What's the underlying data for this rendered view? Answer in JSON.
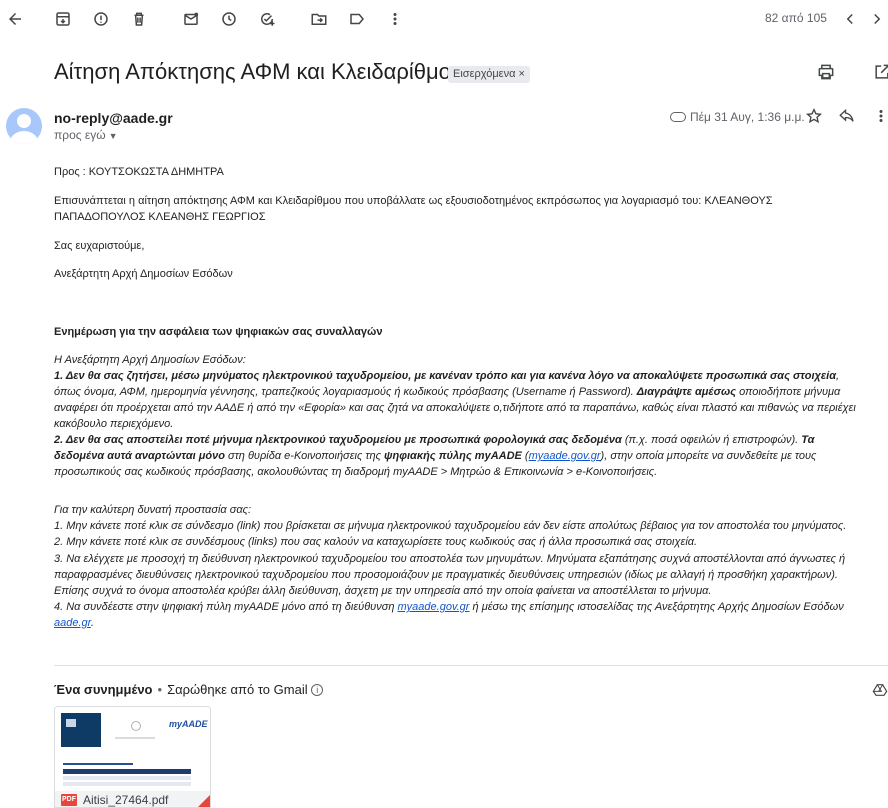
{
  "toolbar": {
    "pager_text": "82 από 105"
  },
  "email": {
    "subject": "Αίτηση Απόκτησης ΑΦΜ και Κλειδαρίθμου",
    "label": "Εισερχόμενα",
    "label_close": "×",
    "sender": "no-reply@aade.gr",
    "recipient": "προς εγώ",
    "date": "Πέμ 31 Αυγ, 1:36 μ.μ."
  },
  "body": {
    "greeting": "Προς : ΚΟΥΤΣΟΚΩΣΤΑ ΔΗΜΗΤΡΑ",
    "para1_line1": "Επισυνάπτεται η αίτηση απόκτησης ΑΦΜ και Κλειδαρίθμου που υποβάλλατε ως εξουσιοδοτημένος εκπρόσωπος για λογαριασμό του: ΚΛΕΑΝΘΟΥΣ",
    "para1_line2": "ΠΑΠΑΔΟΠΟΥΛΟΣ ΚΛΕΑΝΘΗΣ ΓΕΩΡΓΙΟΣ",
    "thanks": "Σας ευχαριστούμε,",
    "signature": "Ανεξάρτητη Αρχή Δημοσίων Εσόδων",
    "security_title": "Ενημέρωση για την ασφάλεια των ψηφιακών σας συναλλαγών",
    "sec_intro": "Η Ανεξάρτητη Αρχή Δημοσίων Εσόδων:",
    "sec1_l1_bold": "1. Δεν θα σας ζητήσει, μέσω μηνύματος ηλεκτρονικού ταχυδρομείου, με κανέναν τρόπο και για κανένα λόγο να αποκαλύψετε προσωπικά σας στοιχεία",
    "sec1_l1_end": ",",
    "sec1_l2_a": "όπως όνομα, ΑΦΜ, ημερομηνία γέννησης, τραπεζικούς λογαριασμούς ή κωδικούς πρόσβασης (Username ή Password). ",
    "sec1_l2_bold": "Διαγράψτε αμέσως",
    "sec1_l2_b": " οποιοδήποτε μήνυμα",
    "sec1_l3": "αναφέρει ότι προέρχεται από την ΑΑΔΕ ή από την «Εφορία» και σας ζητά να αποκαλύψετε ο,τιδήποτε από τα παραπάνω, καθώς είναι πλαστό και πιθανώς να περιέχει",
    "sec1_l4": "κακόβουλο περιεχόμενο.",
    "sec2_l1_bold": "2. Δεν θα σας αποστείλει ποτέ μήνυμα ηλεκτρονικού ταχυδρομείου με προσωπικά φορολογικά σας δεδομένα",
    "sec2_l1_a": " (π.χ. ποσά οφειλών ή επιστροφών). ",
    "sec2_l1_bold2": "Τα",
    "sec2_l2_bold": "δεδομένα αυτά αναρτώνται μόνο",
    "sec2_l2_a": " στη θυρίδα e-Κοινοποιήσεις της ",
    "sec2_l2_bold2": "ψηφιακής πύλης myAADE",
    "sec2_l2_b": " (",
    "sec2_link": "myaade.gov.gr",
    "sec2_l2_c": "), στην οποία μπορείτε να συνδεθείτε με τους",
    "sec2_l3": "προσωπικούς σας κωδικούς πρόσβασης, ακολουθώντας τη διαδρομή myAADE > Μητρώο & Επικοινωνία > e-Κοινοποιήσεις.",
    "tips_intro": "Για την καλύτερη δυνατή προστασία σας:",
    "tip1": "1. Μην κάνετε ποτέ κλικ σε σύνδεσμο (link) που βρίσκεται σε μήνυμα ηλεκτρονικού ταχυδρομείου εάν δεν είστε απολύτως βέβαιος για τον αποστολέα του μηνύματος.",
    "tip2": "2. Μην κάνετε ποτέ κλικ σε συνδέσμους (links) που σας καλούν να καταχωρίσετε τους κωδικούς σας ή άλλα προσωπικά σας στοιχεία.",
    "tip3_l1": "3. Να ελέγχετε με προσοχή τη διεύθυνση ηλεκτρονικού ταχυδρομείου του αποστολέα των μηνυμάτων. Μηνύματα εξαπάτησης συχνά αποστέλλονται από άγνωστες ή",
    "tip3_l2": "παραφρασμένες διευθύνσεις ηλεκτρονικού ταχυδρομείου που προσομοιάζουν με πραγματικές διευθύνσεις υπηρεσιών (ιδίως με αλλαγή ή προσθήκη χαρακτήρων).",
    "tip3_l3": "Επίσης συχνά το όνομα αποστολέα κρύβει άλλη διεύθυνση, άσχετη με την υπηρεσία από την οποία φαίνεται να αποστέλλεται το μήνυμα.",
    "tip4_a": "4. Να συνδέεστε στην ψηφιακή πύλη myAADE μόνο από τη διεύθυνση ",
    "tip4_link1": "myaade.gov.gr",
    "tip4_b": " ή μέσω της επίσημης ιστοσελίδας της Ανεξάρτητης Αρχής Δημοσίων Εσόδων",
    "tip4_link2": "aade.gr",
    "tip4_end": "."
  },
  "attachments": {
    "count_label": "Ένα συνημμένο",
    "scan_note": "Σαρώθηκε από το Gmail",
    "thumb_logo": "myAADE",
    "file_badge": "PDF",
    "file_name": "Aitisi_27464.pdf"
  }
}
